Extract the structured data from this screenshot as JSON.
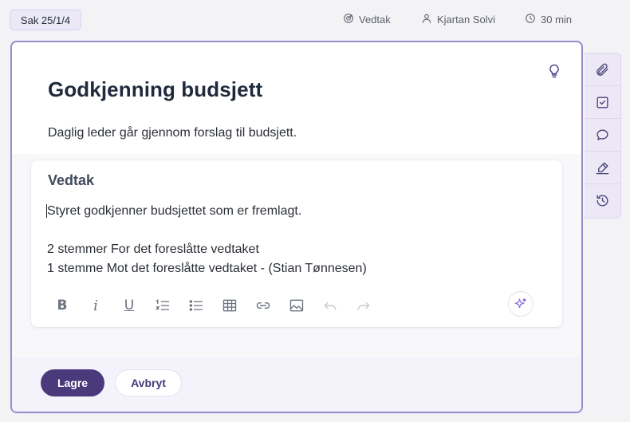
{
  "header": {
    "case_number": "Sak 25/1/4",
    "item_type": "Vedtak",
    "user": "Kjartan Solvi",
    "duration": "30 min"
  },
  "card": {
    "title": "Godkjenning budsjett",
    "description": "Daglig leder går gjennom forslag til budsjett."
  },
  "decision": {
    "heading": "Vedtak",
    "lines": [
      "Styret godkjenner budsjettet som er fremlagt.",
      "",
      "2 stemmer For det foreslåtte vedtaket",
      "1 stemme Mot det foreslåtte vedtaket - (Stian Tønnesen)"
    ]
  },
  "toolbar": {
    "bold": "B",
    "italic": "i",
    "underline": "U"
  },
  "actions": {
    "save_label": "Lagre",
    "cancel_label": "Avbryt"
  },
  "colors": {
    "accent": "#4a3a7c",
    "card_border": "#9b8ac8",
    "rail_bg": "#ece8f6"
  }
}
